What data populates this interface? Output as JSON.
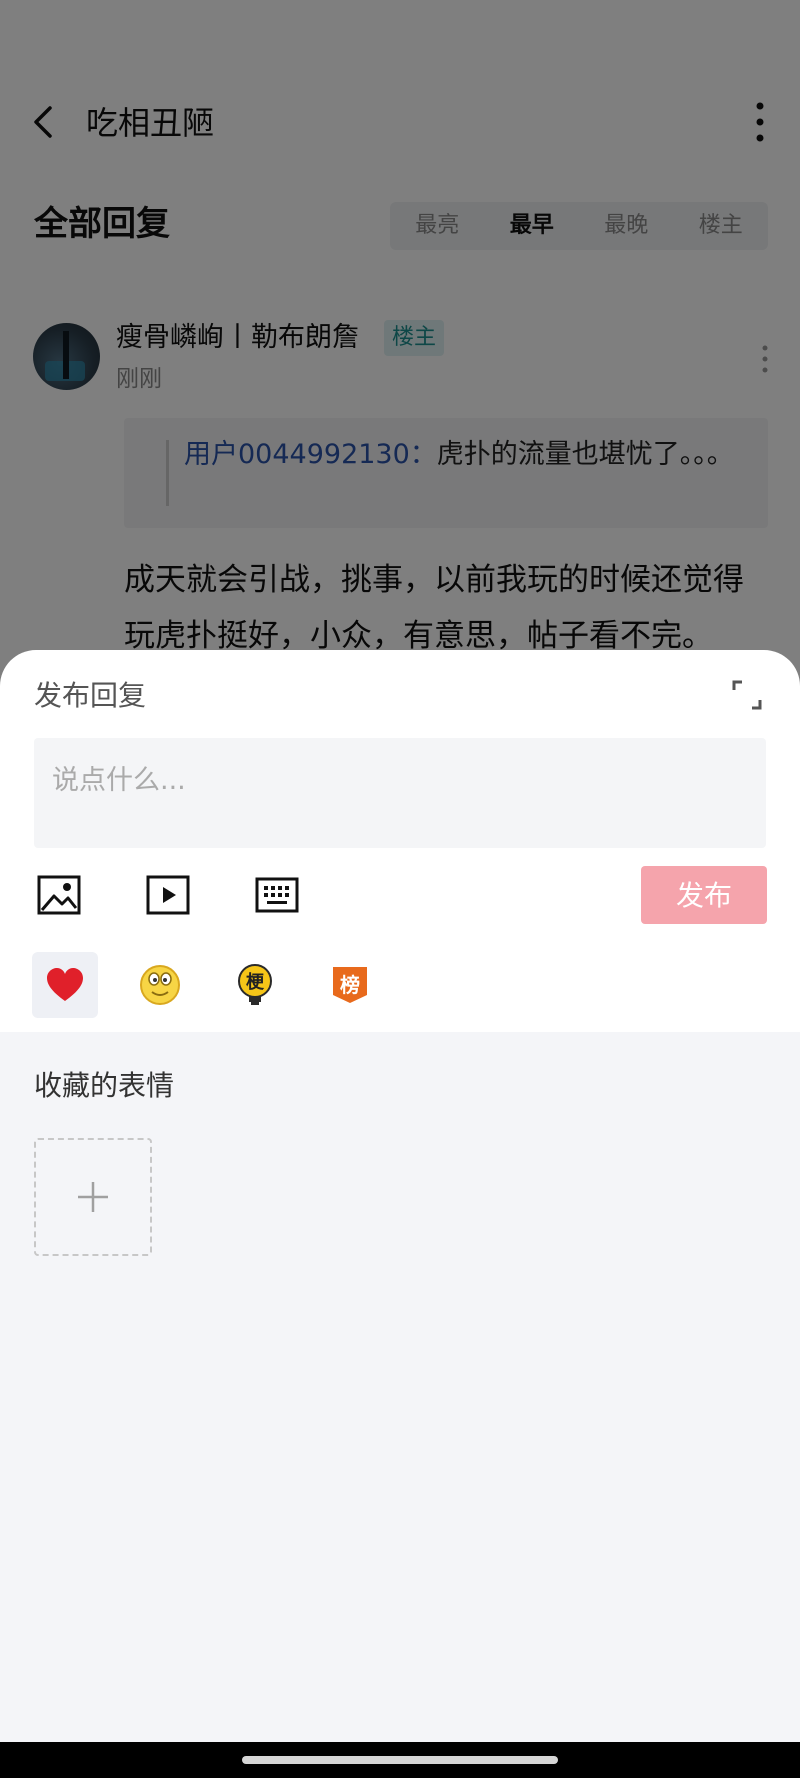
{
  "page": {
    "title": "吃相丑陋",
    "section_title": "全部回复",
    "sort_tabs": [
      {
        "label": "最亮",
        "active": false
      },
      {
        "label": "最早",
        "active": true
      },
      {
        "label": "最晚",
        "active": false
      },
      {
        "label": "楼主",
        "active": false
      }
    ]
  },
  "comment": {
    "username": "瘦骨嶙峋丨勒布朗詹",
    "badge": "楼主",
    "time": "刚刚",
    "quote_user": "用户0044992130：",
    "quote_text": "虎扑的流量也堪忧了。。。",
    "body": "成天就会引战，挑事，以前我玩的时候还觉得玩虎扑挺好，小众，有意思，帖子看不完。"
  },
  "reply_sheet": {
    "title": "发布回复",
    "input_placeholder": "说点什么...",
    "input_value": "",
    "publish_label": "发布",
    "publish_color": "#f5a4ac",
    "tools": [
      "image-icon",
      "video-icon",
      "keyboard-icon"
    ],
    "emoji_tabs": [
      {
        "name": "heart-icon",
        "active": true
      },
      {
        "name": "smiley-face-icon",
        "active": false
      },
      {
        "name": "meme-bulb-icon",
        "glyph": "梗",
        "active": false
      },
      {
        "name": "ranking-icon",
        "glyph": "榜",
        "active": false
      }
    ],
    "favorites_title": "收藏的表情",
    "add_favorite": "plus-icon"
  },
  "colors": {
    "overlay": "rgba(0,0,0,0.5)",
    "quote_user": "#2a52a8",
    "badge_text": "#1c8f8f"
  }
}
